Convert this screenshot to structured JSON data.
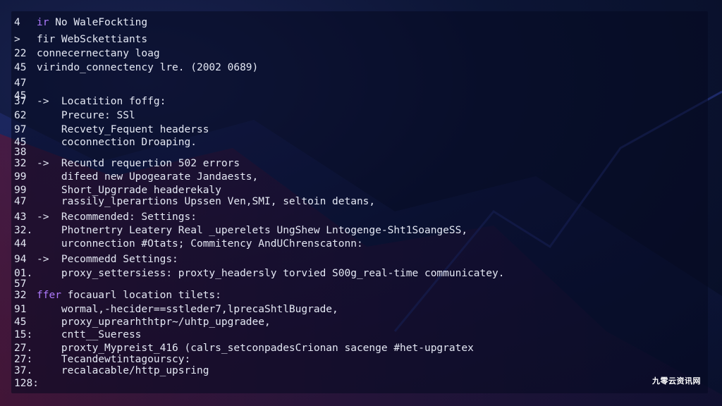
{
  "editor": {
    "lines": [
      {
        "num": "4",
        "text": "ir No WaleFockting",
        "highlight": "ir"
      },
      {
        "num": ">",
        "text": "fir WebSckettiants"
      },
      {
        "num": "22",
        "text": "connecernectany loag"
      },
      {
        "num": "45",
        "text": "virindo_connectency lre. (2002 0689)"
      },
      {
        "num": "47",
        "text": ""
      },
      {
        "num": "45",
        "text": ""
      },
      {
        "num": "37",
        "text": "->  Locatition foffg:"
      },
      {
        "num": "62",
        "text": "    Precure: SSl"
      },
      {
        "num": "97",
        "text": "    Recvety_Fequent headerss"
      },
      {
        "num": "45",
        "text": "    coconnection Droaping."
      },
      {
        "num": "38",
        "text": ""
      },
      {
        "num": "32",
        "text": "->  Recuntd requertion 502 errors"
      },
      {
        "num": "99",
        "text": "    difeed new Upogearate Jandaests,"
      },
      {
        "num": "99",
        "text": "    Short_Upgrrade headerekaly"
      },
      {
        "num": "47",
        "text": "    rassily_lperartions Upssen Ven,SMI, seltoin detans,"
      },
      {
        "num": "43",
        "text": "->  Recommended: Settings:"
      },
      {
        "num": "32.",
        "text": "    Photnertry Leatery Real _uperelets UngShew Lntogenge-Sht1SoangeSS,"
      },
      {
        "num": "44",
        "text": "    urconnection #Otats; Commitency AndUChrenscatonn:"
      },
      {
        "num": "94",
        "text": "->  Pecommedd Settings:"
      },
      {
        "num": "01.",
        "text": "    proxy_settersiess: proxty_headersly torvied S00g_real-time communicatey."
      },
      {
        "num": "57",
        "text": ""
      },
      {
        "num": "32",
        "text": "ffer focauarl location tilets:",
        "highlight": "ffer"
      },
      {
        "num": "91",
        "text": "    wormal,-hecider==sstleder7,lprecaShtlBugrade,"
      },
      {
        "num": "45",
        "text": "    proxy_uprearhthtpr~/uhtp_upgradee,"
      },
      {
        "num": "15:",
        "text": "    cntt__Sueress"
      },
      {
        "num": "27.",
        "text": "    proxty_Mypreist_416 (calrs_setconpadesCrionan sacenge #het-upgratex"
      },
      {
        "num": "27:",
        "text": "    Tecandewtintagourscy:"
      },
      {
        "num": "37.",
        "text": "    recalacable/http_upsring"
      },
      {
        "num": "128:",
        "text": ""
      }
    ]
  },
  "watermark": "九零云资讯网",
  "colors": {
    "background": "#0b1433",
    "text": "#e4e8f4",
    "keyword": "#b07bff"
  }
}
